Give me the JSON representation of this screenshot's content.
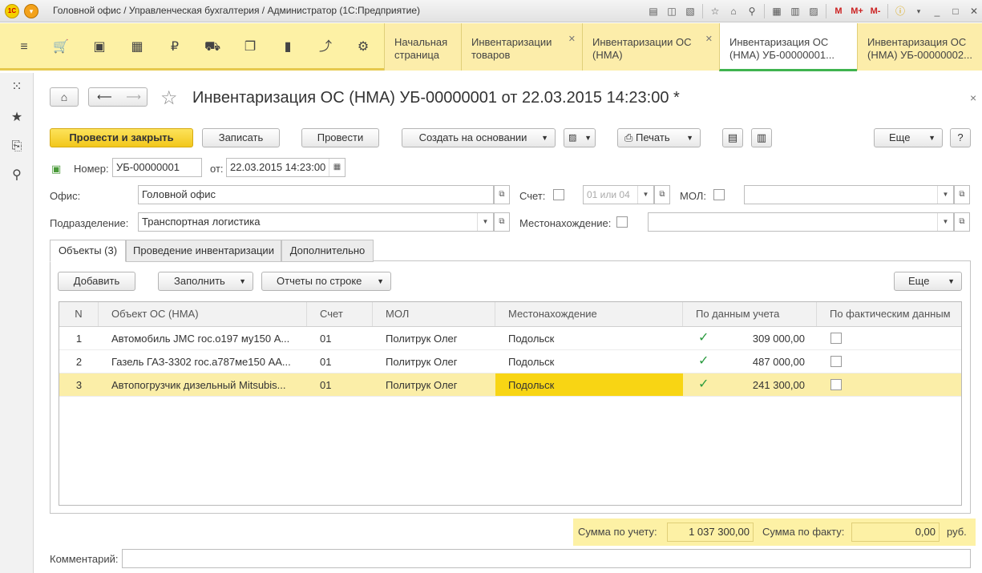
{
  "window": {
    "title": "Головной офис / Управленческая бухгалтерия / Администратор  (1С:Предприятие)",
    "logo_text": "1С"
  },
  "tabs": [
    {
      "label": "Начальная страница",
      "closable": false
    },
    {
      "label": "Инвентаризации товаров",
      "closable": true
    },
    {
      "label": "Инвентаризации ОС (НМА)",
      "closable": true
    },
    {
      "label": "Инвентаризация ОС (НМА) УБ-00000001...",
      "closable": false,
      "active": true
    },
    {
      "label": "Инвентаризация ОС (НМА) УБ-00000002...",
      "closable": false
    }
  ],
  "form": {
    "title": "Инвентаризация ОС (НМА) УБ-00000001 от 22.03.2015 14:23:00 *",
    "close_mark": "×",
    "buttons": {
      "post_close": "Провести и закрыть",
      "save": "Записать",
      "post": "Провести",
      "create_based": "Создать на основании",
      "print": "Печать",
      "more": "Еще",
      "help": "?"
    },
    "number_label": "Номер:",
    "number_value": "УБ-00000001",
    "date_label": "от:",
    "date_value": "22.03.2015 14:23:00",
    "office_label": "Офис:",
    "office_value": "Головной офис",
    "account_label": "Счет:",
    "account_placeholder": "01 или 04",
    "mol_label": "МОЛ:",
    "division_label": "Подразделение:",
    "division_value": "Транспортная логистика",
    "location_label": "Местонахождение:"
  },
  "form_tabs": [
    "Объекты (3)",
    "Проведение инвентаризации",
    "Дополнительно"
  ],
  "table_toolbar": {
    "add": "Добавить",
    "fill": "Заполнить",
    "reports": "Отчеты по строке",
    "more": "Еще"
  },
  "table": {
    "columns": [
      "N",
      "Объект ОС (НМА)",
      "Счет",
      "МОЛ",
      "Местонахождение",
      "По данным учета",
      "По фактическим данным"
    ],
    "rows": [
      {
        "n": "1",
        "object": "Автомобиль JMC гос.о197 му150 А...",
        "account": "01",
        "mol": "Политрук Олег",
        "location": "Подольск",
        "book_checked": true,
        "book_value": "309 000,00",
        "fact_checked": false
      },
      {
        "n": "2",
        "object": "Газель ГАЗ-3302 гос.а787ме150 АА...",
        "account": "01",
        "mol": "Политрук Олег",
        "location": "Подольск",
        "book_checked": true,
        "book_value": "487 000,00",
        "fact_checked": false
      },
      {
        "n": "3",
        "object": "Автопогрузчик дизельный Mitsubis...",
        "account": "01",
        "mol": "Политрук Олег",
        "location": "Подольск",
        "book_checked": true,
        "book_value": "241 300,00",
        "fact_checked": false,
        "selected": true
      }
    ]
  },
  "totals": {
    "book_label": "Сумма по учету:",
    "book_value": "1 037 300,00",
    "fact_label": "Сумма по факту:",
    "fact_value": "0,00",
    "currency": "руб."
  },
  "comment_label": "Комментарий:",
  "colors": {
    "accent": "#fdf1a5",
    "primary_button": "#f5d22a",
    "selection": "#fbeea8",
    "check": "#2b9b3f"
  }
}
